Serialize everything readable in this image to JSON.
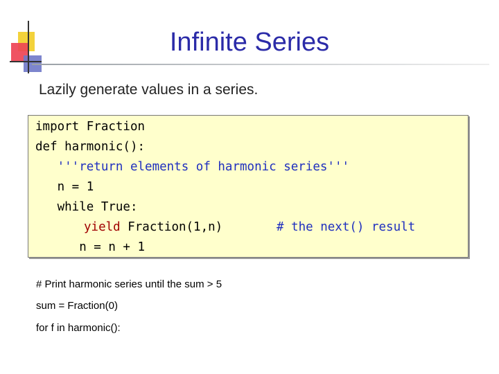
{
  "slide": {
    "title": "Infinite Series",
    "subtitle": "Lazily generate values in a series."
  },
  "code": {
    "lines": [
      {
        "text": "import Fraction"
      },
      {
        "text": "def harmonic():"
      },
      {
        "text": "   '''return elements of harmonic series'''"
      },
      {
        "text": "   n = 1"
      },
      {
        "text": "   while True:"
      },
      {
        "keyword": "yield",
        "rest": " Fraction(1,n)",
        "comment": "# the next() result"
      },
      {
        "text": "      n = n + 1"
      }
    ]
  },
  "notes": [
    "# Print harmonic series until the sum > 5",
    "sum = Fraction(0)",
    "for f in harmonic():"
  ],
  "colors": {
    "title": "#2b2ba8",
    "code_background": "#ffffcc",
    "docstring": "#1f2fbf",
    "keyword": "#a00000"
  }
}
